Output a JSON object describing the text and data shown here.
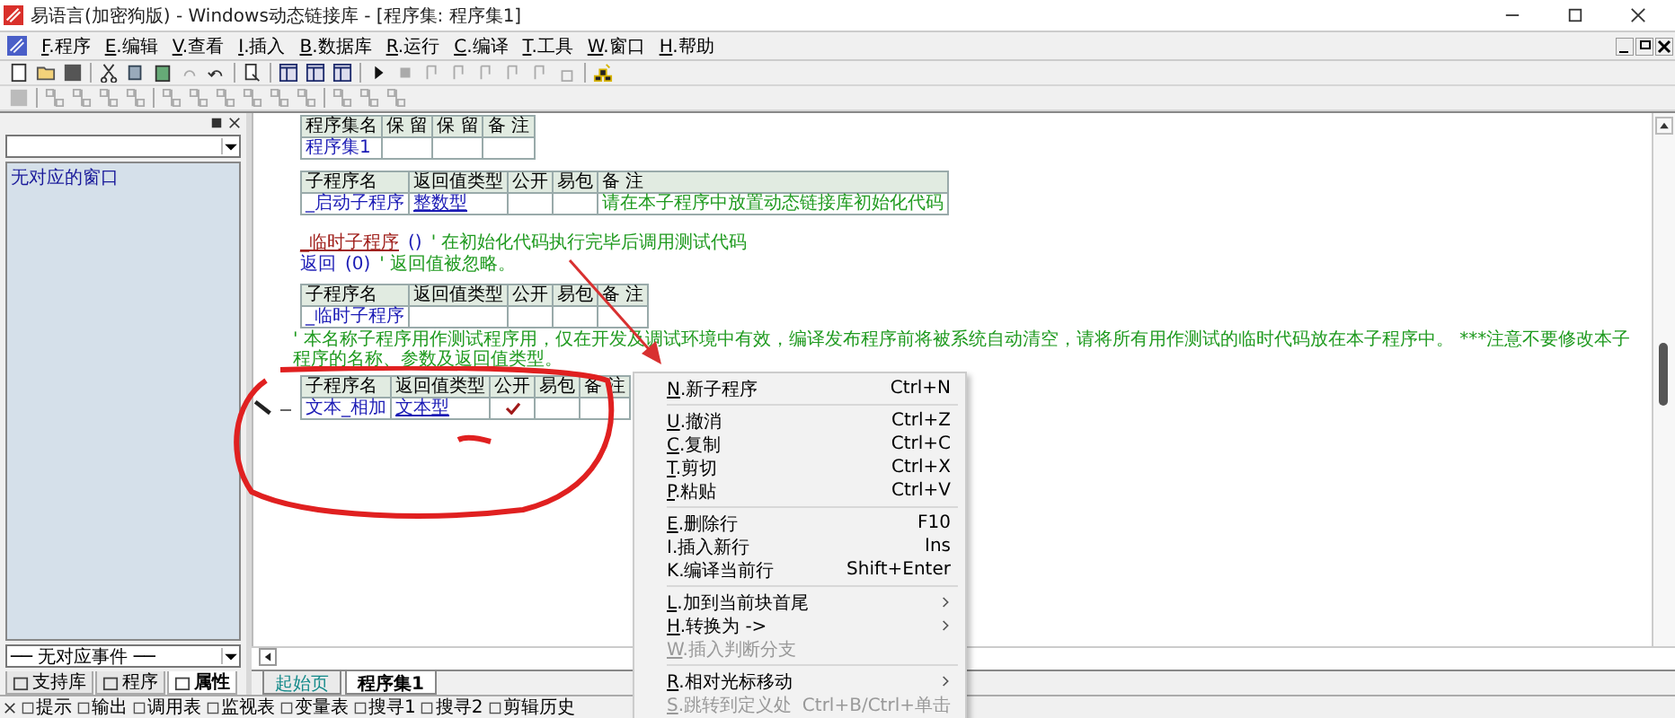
{
  "window": {
    "title": "易语言(加密狗版) - Windows动态链接库 - [程序集: 程序集1]"
  },
  "menu_bar": [
    {
      "key": "F",
      "label": ".程序"
    },
    {
      "key": "E",
      "label": ".编辑"
    },
    {
      "key": "V",
      "label": ".查看"
    },
    {
      "key": "I",
      "label": ".插入"
    },
    {
      "key": "B",
      "label": ".数据库"
    },
    {
      "key": "R",
      "label": ".运行"
    },
    {
      "key": "C",
      "label": ".编译"
    },
    {
      "key": "T",
      "label": ".工具"
    },
    {
      "key": "W",
      "label": ".窗口"
    },
    {
      "key": "H",
      "label": ".帮助"
    }
  ],
  "left_panel": {
    "window_list": [
      {
        "label": "无对应的窗口",
        "selected": false
      }
    ],
    "event_dropdown": "── 无对应事件 ──",
    "tabs": [
      {
        "label": "支持库",
        "selected": false
      },
      {
        "label": "程序",
        "selected": false
      },
      {
        "label": "属性",
        "selected": true
      }
    ]
  },
  "editor": {
    "blocks": [
      {
        "kind": "assembly_table",
        "columns": [
          "程序集名",
          "保 留",
          "保 留",
          "备 注"
        ],
        "row": {
          "name": "程序集1"
        }
      },
      {
        "kind": "sub_table",
        "current": false,
        "columns": [
          "子程序名",
          "返回值类型",
          "公开",
          "易包",
          "备 注"
        ],
        "row": {
          "name": "_启动子程序",
          "type": "整数型",
          "public": false,
          "note": "请在本子程序中放置动态链接库初始化代码"
        }
      },
      {
        "kind": "code",
        "parts": [
          {
            "text": "_临时子程序",
            "kind": "call"
          },
          {
            "text": "()",
            "kind": "keyword"
          },
          {
            "text": "'  在初始化代码执行完毕后调用测试代码",
            "kind": "comment"
          }
        ]
      },
      {
        "kind": "code",
        "parts": [
          {
            "text": "返回",
            "kind": "keyword"
          },
          {
            "text": "(0)",
            "kind": "keyword"
          },
          {
            "text": "'  返回值被忽略。",
            "kind": "comment"
          }
        ]
      },
      {
        "kind": "sub_table",
        "current": false,
        "columns": [
          "子程序名",
          "返回值类型",
          "公开",
          "易包",
          "备 注"
        ],
        "row": {
          "name": "_临时子程序",
          "public": false
        }
      },
      {
        "kind": "comment",
        "text": "'  本名称子程序用作测试程序用，仅在开发及调试环境中有效，编译发布程序前将被系统自动清空，请将所有用作测试的临时代码放在本子程序中。 ***注意不要修改本子程序的名称、参数及返回值类型。"
      },
      {
        "kind": "sub_table",
        "current": true,
        "columns": [
          "子程序名",
          "返回值类型",
          "公开",
          "易包",
          "备 注"
        ],
        "row": {
          "name": "文本_相加",
          "type": "文本型",
          "public": true
        }
      }
    ]
  },
  "editor_tabs": [
    {
      "label": "起始页",
      "selected": false
    },
    {
      "label": "程序集1",
      "selected": true
    }
  ],
  "context_menu": [
    [
      {
        "key": "N",
        "label": ".新子程序",
        "shortcut": "Ctrl+N",
        "underlined": true,
        "submenu": false,
        "disabled": false
      }
    ],
    [
      {
        "key": "U",
        "label": ".撤消",
        "shortcut": "Ctrl+Z",
        "underlined": true,
        "submenu": false,
        "disabled": false
      },
      {
        "key": "C",
        "label": ".复制",
        "shortcut": "Ctrl+C",
        "underlined": true,
        "submenu": false,
        "disabled": false
      },
      {
        "key": "T",
        "label": ".剪切",
        "shortcut": "Ctrl+X",
        "underlined": true,
        "submenu": false,
        "disabled": false
      },
      {
        "key": "P",
        "label": ".粘贴",
        "shortcut": "Ctrl+V",
        "underlined": true,
        "submenu": false,
        "disabled": false
      }
    ],
    [
      {
        "key": "E",
        "label": ".删除行",
        "shortcut": "F10",
        "underlined": true,
        "submenu": false,
        "disabled": false
      },
      {
        "key": "I",
        "label": ".插入新行",
        "shortcut": "Ins",
        "underlined": false,
        "submenu": false,
        "disabled": false
      },
      {
        "key": "K",
        "label": ".编译当前行",
        "shortcut": "Shift+Enter",
        "underlined": false,
        "submenu": false,
        "disabled": false
      }
    ],
    [
      {
        "key": "L",
        "label": ".加到当前块首尾",
        "underlined": true,
        "submenu": true,
        "disabled": false
      },
      {
        "key": "H",
        "label": ".转换为 ->",
        "underlined": true,
        "submenu": true,
        "disabled": false
      },
      {
        "key": "W",
        "label": ".插入判断分支",
        "underlined": true,
        "submenu": false,
        "disabled": true
      }
    ],
    [
      {
        "key": "R",
        "label": ".相对光标移动",
        "underlined": true,
        "submenu": true,
        "disabled": false
      },
      {
        "key": "S",
        "label": ".跳转到定义处",
        "shortcut": "Ctrl+B/Ctrl+单击",
        "underlined": true,
        "submenu": false,
        "disabled": true
      }
    ]
  ],
  "bottom_tabs": [
    "提示",
    "输出",
    "调用表",
    "监视表",
    "变量表",
    "搜寻1",
    "搜寻2",
    "剪辑历史"
  ]
}
